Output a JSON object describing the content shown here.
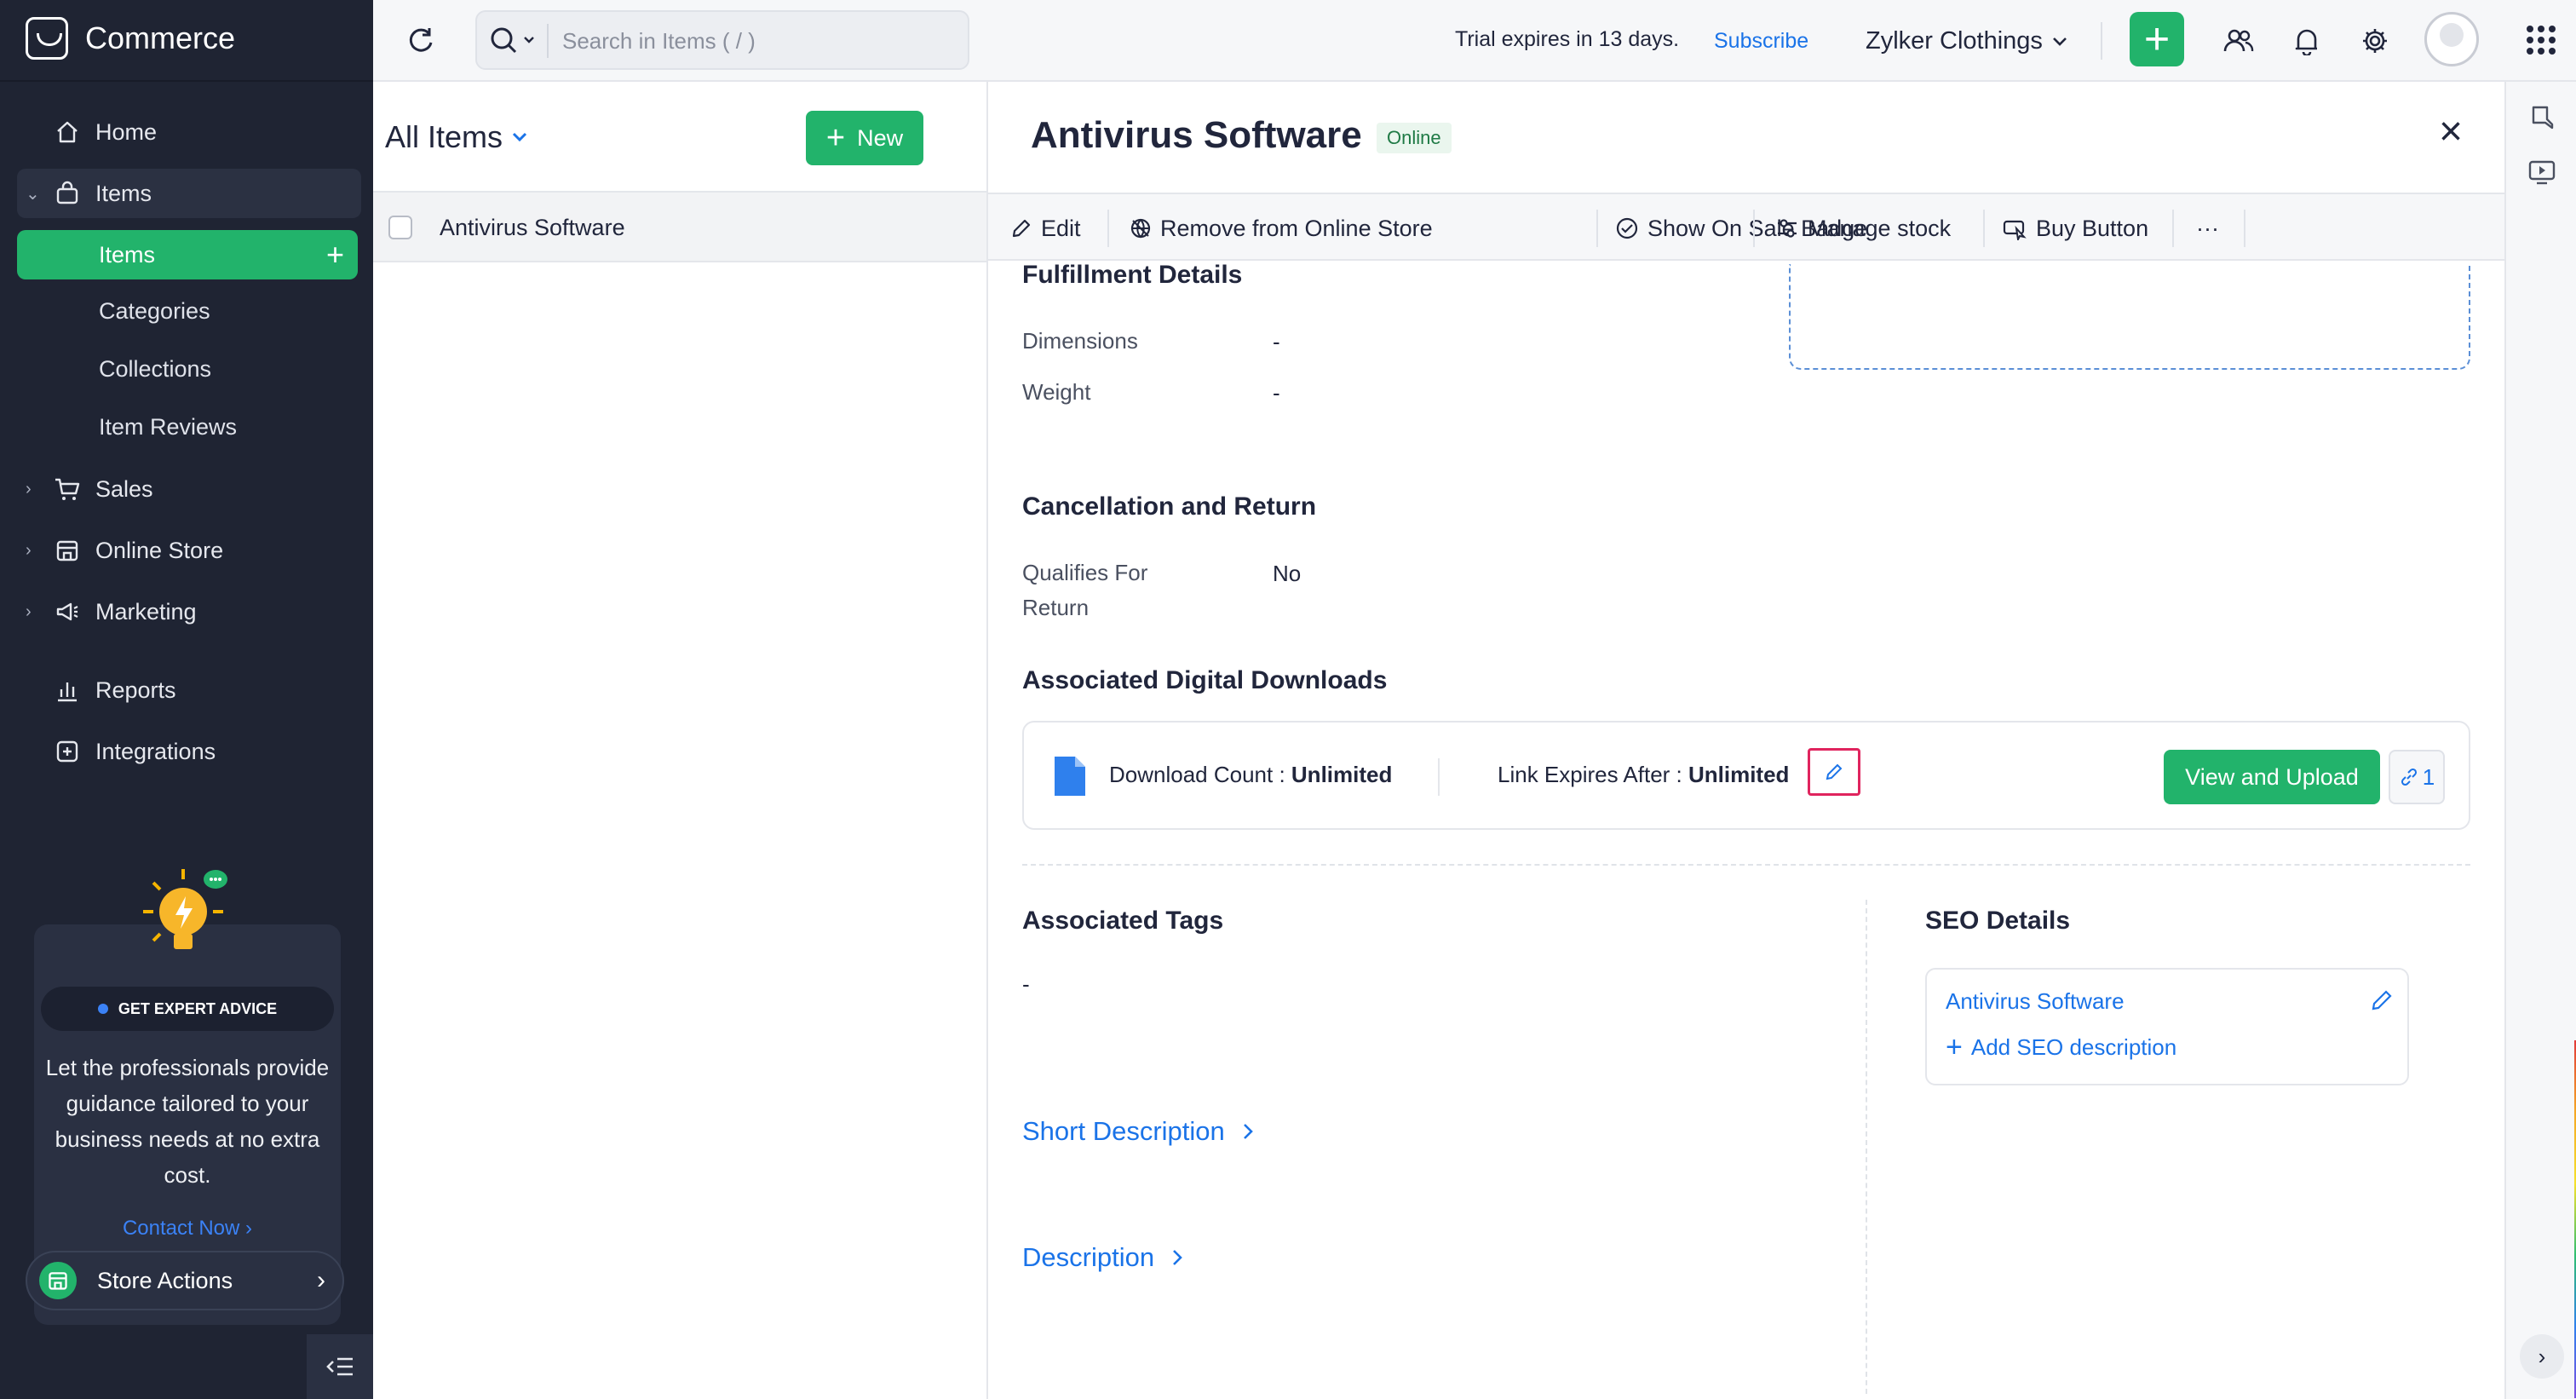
{
  "app": {
    "name": "Commerce"
  },
  "sidebar": {
    "home": "Home",
    "items_group": "Items",
    "items_sub": [
      "Items",
      "Categories",
      "Collections",
      "Item Reviews"
    ],
    "sales": "Sales",
    "online_store": "Online Store",
    "marketing": "Marketing",
    "reports": "Reports",
    "integrations": "Integrations",
    "promo": {
      "badge": "GET EXPERT ADVICE",
      "text": "Let the professionals provide guidance tailored to your business needs at no extra cost.",
      "contact": "Contact Now ›"
    },
    "store_actions": "Store Actions"
  },
  "topbar": {
    "search_placeholder": "Search in Items ( / )",
    "trial": "Trial expires in 13 days.",
    "subscribe": "Subscribe",
    "org": "Zylker Clothings"
  },
  "list": {
    "filter": "All Items",
    "new_label": "New",
    "rows": [
      "Antivirus Software"
    ]
  },
  "detail": {
    "title": "Antivirus Software",
    "status": "Online",
    "toolbar": {
      "edit": "Edit",
      "remove": "Remove from Online Store",
      "sale_badge": "Show On Sale Badge",
      "manage_stock": "Manage stock",
      "buy_button": "Buy Button",
      "more": "···"
    },
    "fulfillment": {
      "title": "Fulfillment Details",
      "dimensions_label": "Dimensions",
      "dimensions_value": "-",
      "weight_label": "Weight",
      "weight_value": "-"
    },
    "cancellation": {
      "title": "Cancellation and Return",
      "qualifies_label": "Qualifies For Return",
      "qualifies_value": "No"
    },
    "downloads": {
      "title": "Associated Digital Downloads",
      "count_label": "Download Count : ",
      "count_value": "Unlimited",
      "expires_label": "Link Expires After : ",
      "expires_value": "Unlimited",
      "view_upload": "View and Upload",
      "link_count": "1"
    },
    "tags": {
      "title": "Associated Tags",
      "value": "-"
    },
    "short_description": "Short Description",
    "description": "Description",
    "seo": {
      "title": "SEO Details",
      "name": "Antivirus Software",
      "add": "Add SEO description"
    }
  },
  "colors": {
    "accent_green": "#22b36b",
    "link_blue": "#1a73e8",
    "sidebar_bg": "#1f2433",
    "highlight": "#e0245e"
  }
}
